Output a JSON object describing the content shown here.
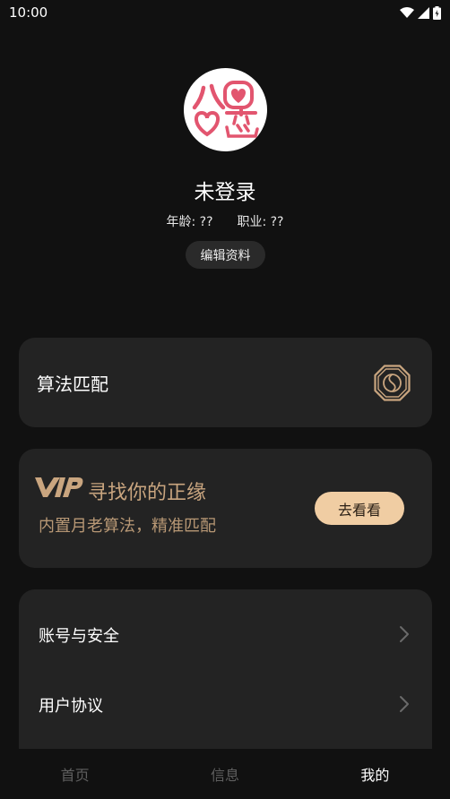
{
  "status_bar": {
    "time": "10:00"
  },
  "profile": {
    "name": "未登录",
    "age_label": "年龄:",
    "age_value": "??",
    "job_label": "职业:",
    "job_value": "??",
    "edit_label": "编辑资料",
    "logo_text_top": "八",
    "logo_text_bottom": "恋"
  },
  "algo_card": {
    "label": "算法匹配"
  },
  "vip_card": {
    "badge": "VIP",
    "title": "寻找你的正缘",
    "subtitle": "内置月老算法，精准匹配",
    "button": "去看看"
  },
  "menu": {
    "items": [
      {
        "label": "账号与安全"
      },
      {
        "label": "用户协议"
      }
    ]
  },
  "tabs": [
    {
      "label": "首页"
    },
    {
      "label": "信息"
    },
    {
      "label": "我的"
    }
  ],
  "colors": {
    "background": "#111111",
    "card": "#232323",
    "vip_gold": "#c9a57f",
    "vip_button": "#f0cda3",
    "logo_pink": "#e2556f"
  }
}
